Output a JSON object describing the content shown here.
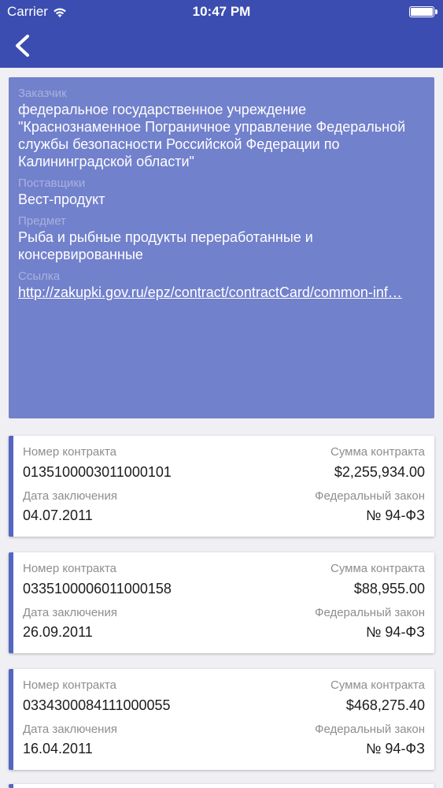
{
  "status_bar": {
    "carrier": "Carrier",
    "time": "10:47 PM"
  },
  "nav": {
    "back_icon": "chevron-left-icon"
  },
  "info": {
    "customer_label": "Заказчик",
    "customer_value": "федеральное государственное учреждение \"Краснознаменное Пограничное управление Федеральной службы безопасности Российской Федерации по Калининградской области\"",
    "suppliers_label": "Поставщики",
    "suppliers_value": "Вест-продукт",
    "subject_label": "Предмет",
    "subject_value": "Рыба и рыбные продукты переработанные и консервированные",
    "link_label": "Ссылка",
    "link_value": "http://zakupki.gov.ru/epz/contract/contractCard/common-inf…"
  },
  "labels": {
    "contract_number": "Номер контракта",
    "contract_sum": "Сумма контракта",
    "date": "Дата заключения",
    "law": "Федеральный закон"
  },
  "contracts": [
    {
      "number": "0135100003011000101",
      "sum": "$2,255,934.00",
      "date": "04.07.2011",
      "law": "№ 94-ФЗ"
    },
    {
      "number": "0335100006011000158",
      "sum": "$88,955.00",
      "date": "26.09.2011",
      "law": "№ 94-ФЗ"
    },
    {
      "number": "0334300084111000055",
      "sum": "$468,275.40",
      "date": "16.04.2011",
      "law": "№ 94-ФЗ"
    }
  ],
  "colors": {
    "header": "#3c4db1",
    "info_card": "#7281cc",
    "card_accent": "#5566c2"
  }
}
